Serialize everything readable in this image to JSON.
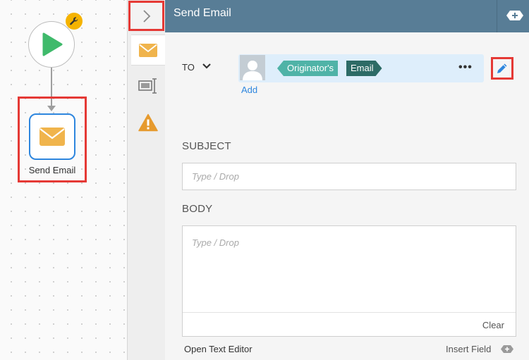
{
  "canvas": {
    "nodes": [
      {
        "id": "start",
        "icon": "play-icon",
        "badge_icon": "wrench-icon"
      },
      {
        "id": "send-email",
        "icon": "envelope-icon",
        "label": "Send Email"
      }
    ]
  },
  "rail": {
    "collapse_icon": "chevron-right-icon",
    "tabs": [
      {
        "icon": "envelope-icon",
        "active": true
      },
      {
        "icon": "text-field-icon",
        "active": false
      },
      {
        "icon": "warning-icon",
        "active": false
      }
    ]
  },
  "header": {
    "title": "Send Email",
    "add_icon": "add-tag-icon"
  },
  "to": {
    "label": "TO",
    "recipient": {
      "prefix": "Originator's",
      "field": "Email"
    },
    "add_link": "Add",
    "more_icon": "more-icon",
    "edit_icon": "pencil-icon"
  },
  "subject": {
    "label": "SUBJECT",
    "placeholder": "Type / Drop"
  },
  "body": {
    "label": "BODY",
    "placeholder": "Type / Drop",
    "clear_label": "Clear"
  },
  "footer": {
    "open_editor_label": "Open Text Editor",
    "insert_field_label": "Insert Field"
  },
  "colors": {
    "header_bg": "#587d96",
    "accent_blue": "#2e86de",
    "chip_light": "#4fb3a7",
    "chip_dark": "#2d6b66",
    "highlight_red": "#e53935",
    "play_green": "#3fba6b",
    "envelope_orange": "#f0b44c"
  }
}
